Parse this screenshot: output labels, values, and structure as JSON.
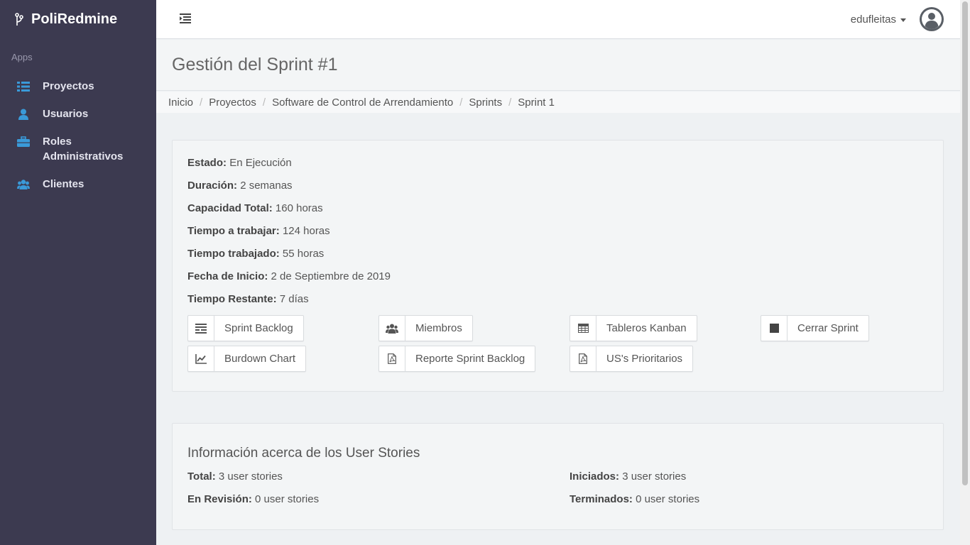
{
  "app": {
    "name": "PoliRedmine"
  },
  "sidebar": {
    "section": "Apps",
    "items": [
      {
        "label": "Proyectos",
        "icon": "list-icon"
      },
      {
        "label": "Usuarios",
        "icon": "user-icon"
      },
      {
        "label": "Roles Administrativos",
        "icon": "briefcase-icon"
      },
      {
        "label": "Clientes",
        "icon": "users-icon"
      }
    ]
  },
  "topbar": {
    "username": "edufleitas"
  },
  "page": {
    "title": "Gestión del Sprint #1"
  },
  "breadcrumb": [
    "Inicio",
    "Proyectos",
    "Software de Control de Arrendamiento",
    "Sprints",
    "Sprint 1"
  ],
  "sprint": {
    "fields": [
      {
        "label": "Estado:",
        "value": "En Ejecución"
      },
      {
        "label": "Duración:",
        "value": "2 semanas"
      },
      {
        "label": "Capacidad Total:",
        "value": "160 horas"
      },
      {
        "label": "Tiempo a trabajar:",
        "value": "124 horas"
      },
      {
        "label": "Tiempo trabajado:",
        "value": "55 horas"
      },
      {
        "label": "Fecha de Inicio:",
        "value": "2 de Septiembre de 2019"
      },
      {
        "label": "Tiempo Restante:",
        "value": "7 días"
      }
    ],
    "buttons": {
      "sprint_backlog": "Sprint Backlog",
      "miembros": "Miembros",
      "tableros_kanban": "Tableros Kanban",
      "cerrar_sprint": "Cerrar Sprint",
      "burdown_chart": "Burdown Chart",
      "reporte_sprint_backlog": "Reporte Sprint Backlog",
      "us_prioritarios": "US's Prioritarios"
    }
  },
  "user_stories": {
    "title": "Información acerca de los User Stories",
    "total": {
      "label": "Total:",
      "value": "3 user stories"
    },
    "iniciados": {
      "label": "Iniciados:",
      "value": "3 user stories"
    },
    "en_revision": {
      "label": "En Revisión:",
      "value": "0 user stories"
    },
    "terminados": {
      "label": "Terminados:",
      "value": "0 user stories"
    }
  },
  "colors": {
    "sidebar": "#3c3a50",
    "accent": "#3a9ad9",
    "text": "#555555"
  }
}
